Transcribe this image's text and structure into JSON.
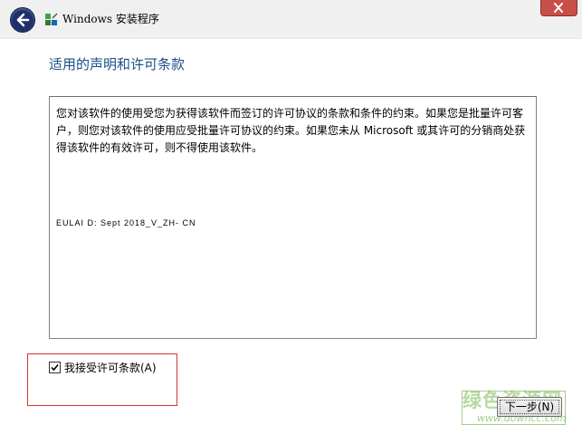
{
  "window": {
    "title": "Windows 安装程序"
  },
  "page": {
    "title": "适用的声明和许可条款"
  },
  "license": {
    "text": "您对该软件的使用受您为获得该软件而签订的许可协议的条款和条件的约束。如果您是批量许可客户，则您对该软件的使用应受批量许可协议的约束。如果您未从 Microsoft 或其许可的分销商处获得该软件的有效许可，则不得使用该软件。",
    "eula_id": "EULAI D: Sept 2018_V_ZH- CN"
  },
  "accept": {
    "label": "我接受许可条款(A)",
    "checked": true
  },
  "buttons": {
    "next_label": "下一步(N)"
  },
  "watermark": {
    "text": "绿色资源网",
    "sub": "www.downcc.com"
  },
  "colors": {
    "title_blue": "#1b4f8a",
    "highlight_red": "#d9342b",
    "back_button": "#1e2f6b",
    "close_button": "#c84f48"
  }
}
